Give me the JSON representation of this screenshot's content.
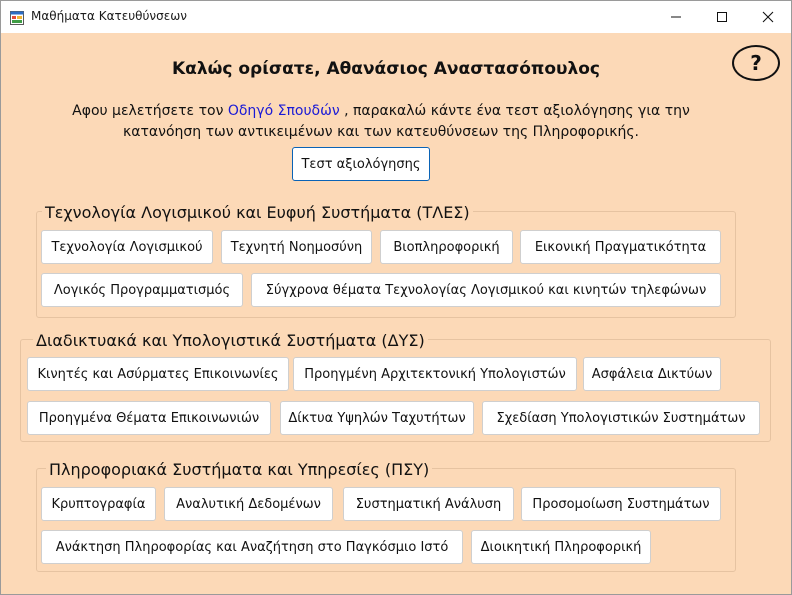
{
  "window": {
    "title": "Μαθήματα Κατευθύνσεων",
    "help_label": "?"
  },
  "header": {
    "welcome": "Καλώς ορίσατε, Αθανάσιος Αναστασόπουλος",
    "intro_before": "Αφου μελετήσετε τον ",
    "intro_link": "Οδηγό Σπουδών",
    "intro_after_line1": " , παρακαλώ κάντε ένα τεστ αξιολόγησης για την",
    "intro_line2": "κατανόηση των αντικειμένων και των κατευθύνσεων της Πληροφορικής.",
    "test_button": "Τεστ αξιολόγησης"
  },
  "groups": [
    {
      "title": "Τεχνολογία Λογισμικού και Ευφυή Συστήματα (ΤΛΕΣ)",
      "courses": [
        "Τεχνολογία Λογισμικού",
        "Τεχνητή Νοημοσύνη",
        "Βιοπληροφορική",
        "Εικονική Πραγματικότητα",
        "Λογικός Προγραμματισμός",
        "Σύγχρονα θέματα Τεχνολογίας Λογισμικού και κινητών τηλεφώνων"
      ]
    },
    {
      "title": "Διαδικτυακά και Υπολογιστικά Συστήματα (ΔΥΣ)",
      "courses": [
        "Κινητές και Ασύρματες Επικοινωνίες",
        "Προηγμένη Αρχιτεκτονική Υπολογιστών",
        "Ασφάλεια Δικτύων",
        "Προηγμένα Θέματα Επικοινωνιών",
        "Δίκτυα Υψηλών Ταχυτήτων",
        "Σχεδίαση Υπολογιστικών Συστημάτων"
      ]
    },
    {
      "title": "Πληροφοριακά Συστήματα και Υπηρεσίες (ΠΣΥ)",
      "courses": [
        "Κρυπτογραφία",
        "Αναλυτική Δεδομένων",
        "Συστηματική Ανάλυση",
        "Προσομοίωση Συστημάτων",
        "Ανάκτηση Πληροφορίας και Αναζήτηση στο Παγκόσμιο Ιστό",
        "Διοικητική Πληροφορική"
      ]
    }
  ],
  "icons": {
    "app": "app-window-icon",
    "minimize": "minimize-icon",
    "maximize": "maximize-icon",
    "close": "close-icon",
    "help": "help-icon"
  },
  "colors": {
    "background": "#fcd9b7",
    "link": "#1a1ad6",
    "primary_button_border": "#0a63b6"
  }
}
